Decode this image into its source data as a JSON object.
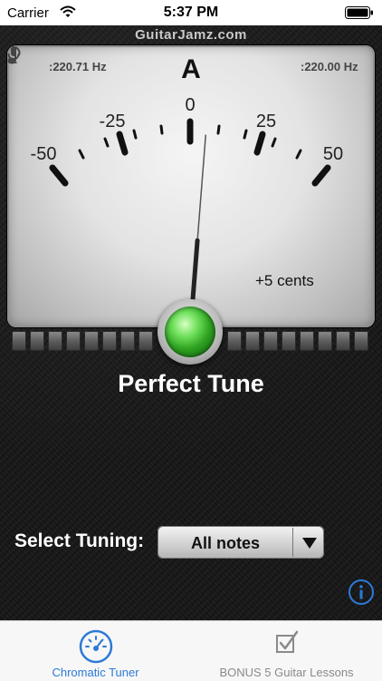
{
  "status_bar": {
    "carrier": "Carrier",
    "time": "5:37 PM"
  },
  "header": {
    "site": "GuitarJamz.com"
  },
  "meter": {
    "note": "A",
    "input_frequency": ":220.71 Hz",
    "reference_frequency": ":220.00 Hz",
    "cents_label": "+5 cents",
    "scale_labels": [
      "-50",
      "-25",
      "0",
      "25",
      "50"
    ],
    "needle_cents": 5
  },
  "tune_status": "Perfect Tune",
  "tuning": {
    "label": "Select Tuning:",
    "value": "All notes"
  },
  "tabs": [
    {
      "label": "Chromatic Tuner",
      "icon": "speedometer-icon",
      "active": true
    },
    {
      "label": "BONUS 5 Guitar Lessons",
      "icon": "checkbox-icon",
      "active": false
    }
  ],
  "colors": {
    "accent": "#2c7ad6",
    "lamp_green": "#3fbf2c"
  }
}
